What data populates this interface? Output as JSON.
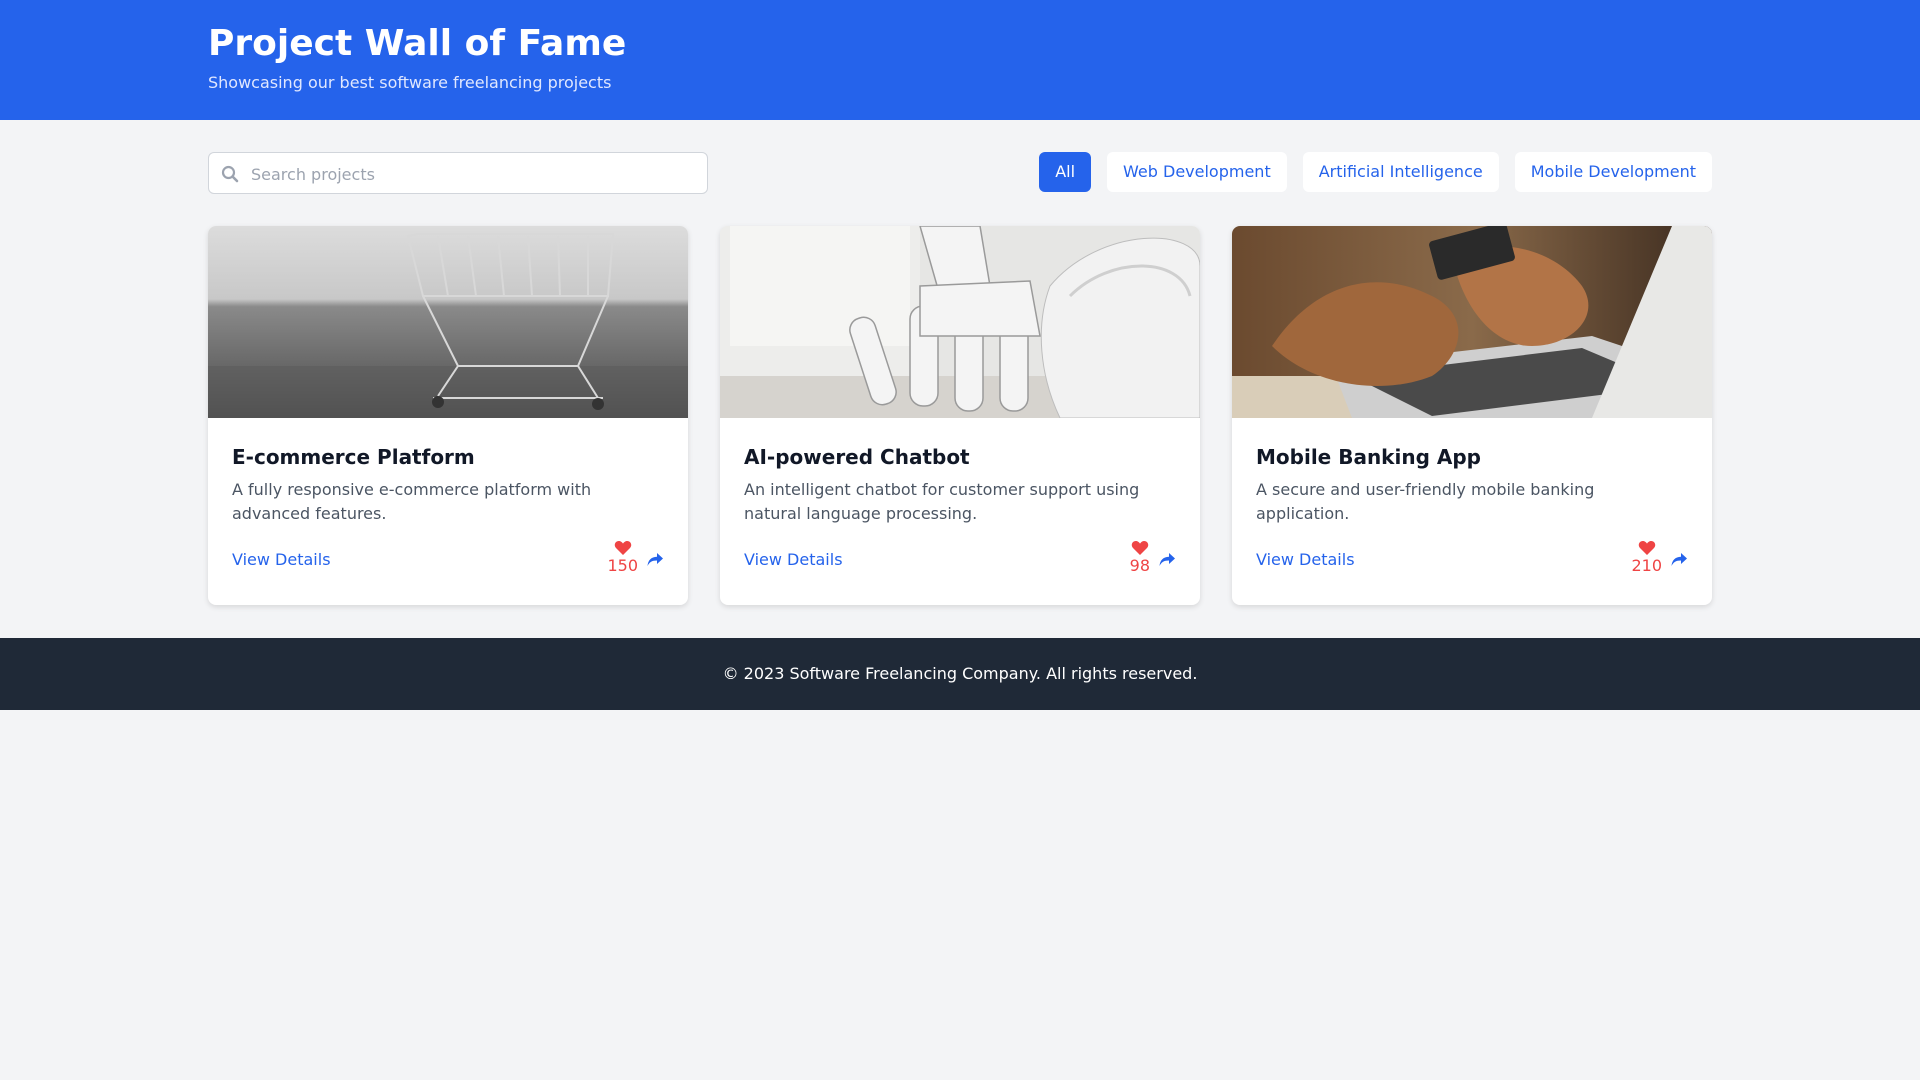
{
  "header": {
    "title": "Project Wall of Fame",
    "subtitle": "Showcasing our best software freelancing projects"
  },
  "search": {
    "placeholder": "Search projects",
    "value": "",
    "icon": "search-icon"
  },
  "filters": [
    {
      "label": "All",
      "active": true
    },
    {
      "label": "Web Development",
      "active": false
    },
    {
      "label": "Artificial Intelligence",
      "active": false
    },
    {
      "label": "Mobile Development",
      "active": false
    }
  ],
  "projects": [
    {
      "title": "E-commerce Platform",
      "description": "A fully responsive e-commerce platform with advanced features.",
      "link_label": "View Details",
      "likes": "150",
      "image": "shopping-cart-photo"
    },
    {
      "title": "AI-powered Chatbot",
      "description": "An intelligent chatbot for customer support using natural language processing.",
      "link_label": "View Details",
      "likes": "98",
      "image": "robot-hand-photo"
    },
    {
      "title": "Mobile Banking App",
      "description": "A secure and user-friendly mobile banking application.",
      "link_label": "View Details",
      "likes": "210",
      "image": "laptop-card-photo"
    }
  ],
  "footer": {
    "text": "© 2023 Software Freelancing Company. All rights reserved."
  },
  "colors": {
    "primary": "#2563eb",
    "like": "#ef4444",
    "footer_bg": "#1f2937",
    "page_bg": "#f3f4f6"
  }
}
